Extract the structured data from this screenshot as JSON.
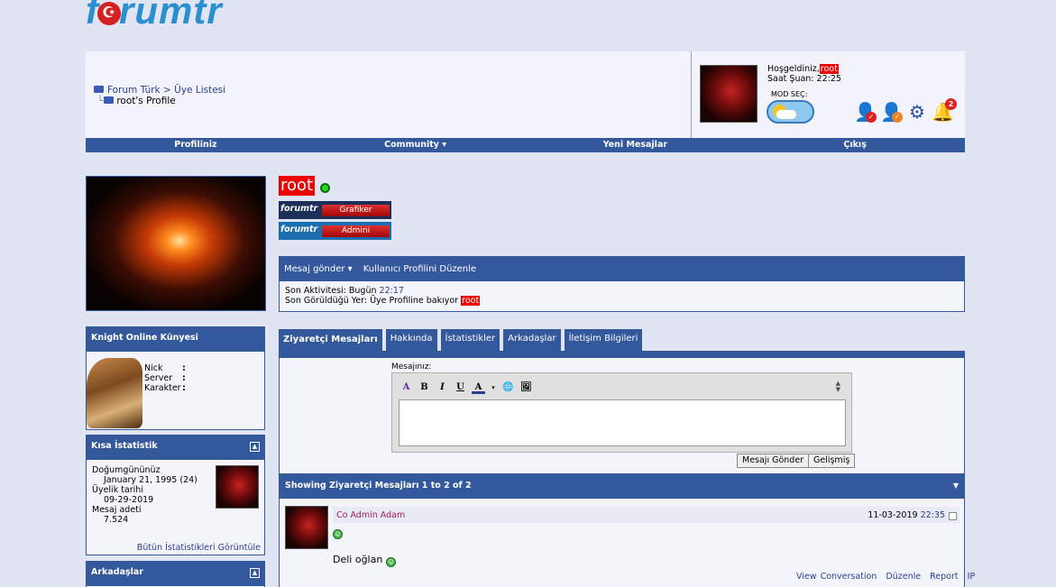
{
  "logo": {
    "text_before": "f",
    "text_after": "rumtr",
    "flag_glyph": "☪"
  },
  "breadcrumb": {
    "root": "Forum Türk",
    "sep": ">",
    "section": "Üye Listesi",
    "current": "root's Profile"
  },
  "welcome": {
    "greeting": "Hoşgeldiniz,",
    "username": "root",
    "time_label": "Saat Şuan:",
    "time": "22:25",
    "mode_label": "MOD SEÇ:"
  },
  "header_icons": {
    "notification_count": "2"
  },
  "nav": {
    "profile": "Profiliniz",
    "community": "Community ▾",
    "new_messages": "Yeni Mesajlar",
    "logout": "Çıkış"
  },
  "profile": {
    "username": "root",
    "ranks": [
      {
        "logo": "forumtr",
        "title": "Grafiker"
      },
      {
        "logo": "forumtr",
        "title": "Admini"
      }
    ],
    "actions": {
      "send_message": "Mesaj gönder ▾",
      "edit_profile": "Kullanıcı Profilini Düzenle"
    },
    "last_activity_label": "Son Aktivitesi: Bugün",
    "last_activity_time": "22:17",
    "last_seen_label": "Son Görüldüğü Yer: Üye Profiline bakıyor",
    "last_seen_user": "root"
  },
  "knight_block": {
    "title": "Knight Online Künyesi",
    "fields": [
      {
        "label": "Nick",
        "value": ":"
      },
      {
        "label": "Server",
        "value": ":"
      },
      {
        "label": "Karakter",
        "value": ":"
      }
    ]
  },
  "stats_block": {
    "title": "Kısa İstatistik",
    "birthday_label": "Doğumgününüz",
    "birthday": "January 21, 1995 (24)",
    "joined_label": "Üyelik tarihi",
    "joined": "09-29-2019",
    "posts_label": "Mesaj adeti",
    "posts": "7.524",
    "footer": "Bütün İstatistikleri Görüntüle"
  },
  "friends_block": {
    "title": "Arkadaşlar"
  },
  "tabs": [
    "Ziyaretçi Mesajları",
    "Hakkında",
    "İstatistikler",
    "Arkadaşlar",
    "İletişim Bilgileri"
  ],
  "composer": {
    "label": "Mesajınız:",
    "submit": "Mesajı Gönder",
    "advanced": "Gelişmiş"
  },
  "showing": "Showing Ziyaretçi Mesajları 1 to 2 of 2",
  "message": {
    "author": "Co Admin Adam",
    "date": "11-03-2019",
    "time": "22:35",
    "text": "Deli oğlan",
    "links": [
      "View Conversation",
      "Düzenle",
      "Report",
      "IP"
    ]
  }
}
